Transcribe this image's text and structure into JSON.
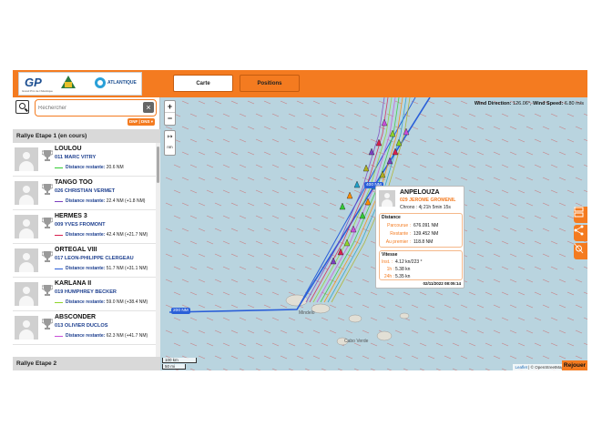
{
  "header": {
    "logo_text": "GP",
    "logo_subtext": "Grand Prix de l'Atlantique",
    "partner_logo_text": "ATLANTIQUE",
    "tabs": [
      {
        "label": "Carte",
        "active": true
      },
      {
        "label": "Positions",
        "active": false
      }
    ]
  },
  "sidebar": {
    "search_placeholder": "Rechercher",
    "clear_glyph": "×",
    "filter_tag": "DNF | DNS ▾",
    "section_current": "Rallye Etape 1 (en cours)",
    "section_next": "Rallye Etape 2",
    "distance_label": "Distance restante:",
    "boats": [
      {
        "name": "LOULOU",
        "skipper": "011 MARC VITRY",
        "distance": "20.6 NM",
        "color": "#33cc33"
      },
      {
        "name": "TANGO TOO",
        "skipper": "026 CHRISTIAN VERMET",
        "distance": "22.4 NM (+1.8 NM)",
        "color": "#7b3fbf"
      },
      {
        "name": "HERMES 3",
        "skipper": "009 YVES FROMONT",
        "distance": "42.4 NM (+21.7 NM)",
        "color": "#d8204e"
      },
      {
        "name": "ORTEGAL VIII",
        "skipper": "017 LEON-PHILIPPE CLERGEAU",
        "distance": "51.7 NM (+31.1 NM)",
        "color": "#2b5fd8"
      },
      {
        "name": "KARLANA II",
        "skipper": "019 HUMPHREY BECKER",
        "distance": "59.0 NM (+38.4 NM)",
        "color": "#8fd42a"
      },
      {
        "name": "ABSCONDER",
        "skipper": "013 OLIVIER DUCLOS",
        "distance": "62.3 NM (+41.7 NM)",
        "color": "#c94fd8"
      }
    ]
  },
  "map": {
    "wind_direction_label": "Wind Direction:",
    "wind_direction_value": "126.06°",
    "wind_speed_label": "Wind Speed:",
    "wind_speed_value": "6.80 m/s",
    "zoom_in": "+",
    "zoom_out": "−",
    "measure_glyph": "↦",
    "measure_unit": "nm",
    "route_tag_200": "200 NM",
    "route_tag_400": "400 NM",
    "land_label_mindelo": "Mindelo",
    "land_label_cabo_verde": "Cabo Verde",
    "scale_km": "100 km",
    "scale_mi": "50 mi",
    "attribution_leaflet": "Leaflet",
    "attribution_rest": "| © OpenStreetMap",
    "replay_label": "Rejouer"
  },
  "popup": {
    "name": "ANPELOUZA",
    "skipper": "029 JEROME GROMENIL",
    "chrono": "Chrono : 4j 21h 5min 15s",
    "distance_title": "Distance",
    "parcourue_label": "Parcourue :",
    "parcourue_value": "676.091 NM",
    "restante_label": "Restante :",
    "restante_value": "139.452 NM",
    "premier_label": "Au premier :",
    "premier_value": "118.8 NM",
    "speed_title": "Vitesse",
    "inst_label": "Inst. :",
    "inst_value": "4.12 kn/223 °",
    "h1_label": "1h :",
    "h1_value": "5.38 kn",
    "h24_label": "24h :",
    "h24_value": "5.35 kn",
    "timestamp": "02/11/2022 08:05:14"
  }
}
